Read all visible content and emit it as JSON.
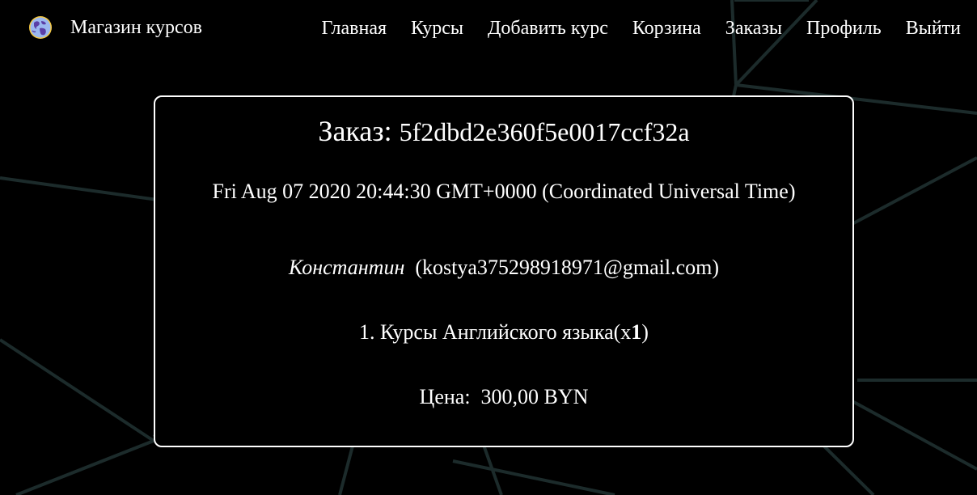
{
  "navbar": {
    "brand_name": "Магазин курсов",
    "brand_logo_icon": "globe-icon",
    "links": [
      {
        "label": "Главная"
      },
      {
        "label": "Курсы"
      },
      {
        "label": "Добавить курс"
      },
      {
        "label": "Корзина"
      },
      {
        "label": "Заказы"
      },
      {
        "label": "Профиль"
      },
      {
        "label": "Выйти"
      }
    ]
  },
  "order": {
    "title_label": "Заказ:",
    "id": "5f2dbd2e360f5e0017ccf32a",
    "date": "Fri Aug 07 2020 20:44:30 GMT+0000 (Coordinated Universal Time)",
    "user_name": "Константин",
    "user_email": "kostya375298918971@gmail.com",
    "items": [
      {
        "number": "1.",
        "title": "Курсы Английского языка",
        "count": "1"
      }
    ],
    "price_label": "Цена:",
    "price": "300,00 BYN"
  },
  "colors": {
    "background": "#000000",
    "text": "#ffffff",
    "card_border": "#ffffff",
    "bg_lines": "#1c2b2b"
  }
}
